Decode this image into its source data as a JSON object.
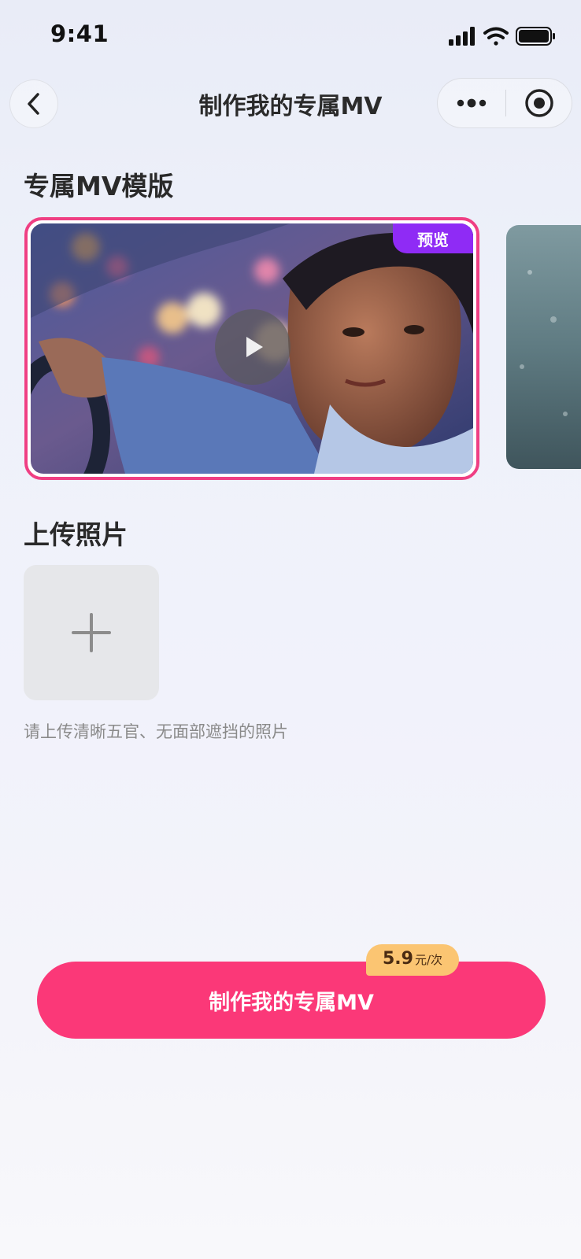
{
  "status_bar": {
    "time": "9:41"
  },
  "nav": {
    "title": "制作我的专属MV"
  },
  "templates": {
    "section_title": "专属MV模版",
    "items": [
      {
        "badge": "预览",
        "selected": true
      },
      {
        "selected": false
      }
    ]
  },
  "upload": {
    "section_title": "上传照片",
    "hint": "请上传清晰五官、无面部遮挡的照片"
  },
  "action": {
    "button_label": "制作我的专属MV",
    "price_amount": "5.9",
    "price_unit": "元/次"
  },
  "colors": {
    "accent": "#fb3878",
    "selection_border": "#ef3f83",
    "badge": "#8f2bf5",
    "price_tag": "#fbc572"
  },
  "icons": [
    "back-icon",
    "more-icon",
    "target-icon",
    "play-icon",
    "plus-icon",
    "signal-icon",
    "wifi-icon",
    "battery-icon"
  ]
}
